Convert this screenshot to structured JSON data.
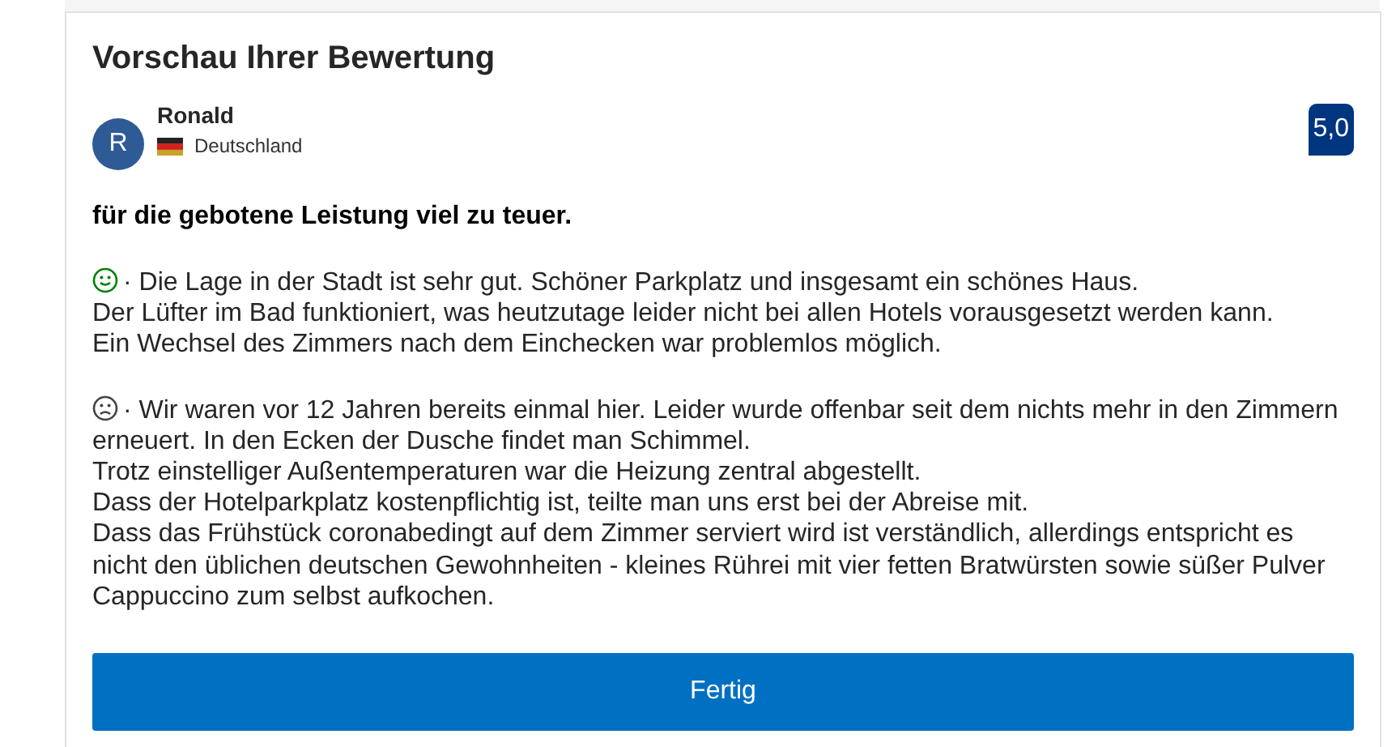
{
  "title": "Vorschau Ihrer Bewertung",
  "reviewer": {
    "initial": "R",
    "name": "Ronald",
    "country": "Deutschland"
  },
  "score": "5,0",
  "headline": "für die gebotene Leistung viel zu teuer.",
  "sections": [
    {
      "kind": "positive",
      "lines": [
        "· Die Lage in der Stadt ist sehr gut. Schöner Parkplatz und insgesamt ein schönes Haus.",
        "Der Lüfter im Bad funktioniert, was heutzutage leider nicht bei allen Hotels vorausgesetzt werden kann.",
        "Ein Wechsel des Zimmers nach dem Einchecken war problemlos möglich."
      ]
    },
    {
      "kind": "negative",
      "lines": [
        "· Wir waren vor 12 Jahren bereits einmal hier. Leider wurde offenbar seit dem nichts mehr in den Zimmern",
        "erneuert. In den Ecken der Dusche findet man Schimmel.",
        "Trotz einstelliger Außentemperaturen war die Heizung zentral abgestellt.",
        "Dass der Hotelparkplatz kostenpflichtig ist, teilte man uns erst bei der Abreise mit.",
        "Dass das Frühstück coronabedingt auf dem Zimmer serviert wird ist verständlich, allerdings entspricht es",
        "nicht den üblichen deutschen Gewohnheiten - kleines Rührei mit vier fetten Bratwürsten sowie süßer Pulver",
        "Cappuccino zum selbst aufkochen."
      ]
    }
  ],
  "button": "Fertig"
}
